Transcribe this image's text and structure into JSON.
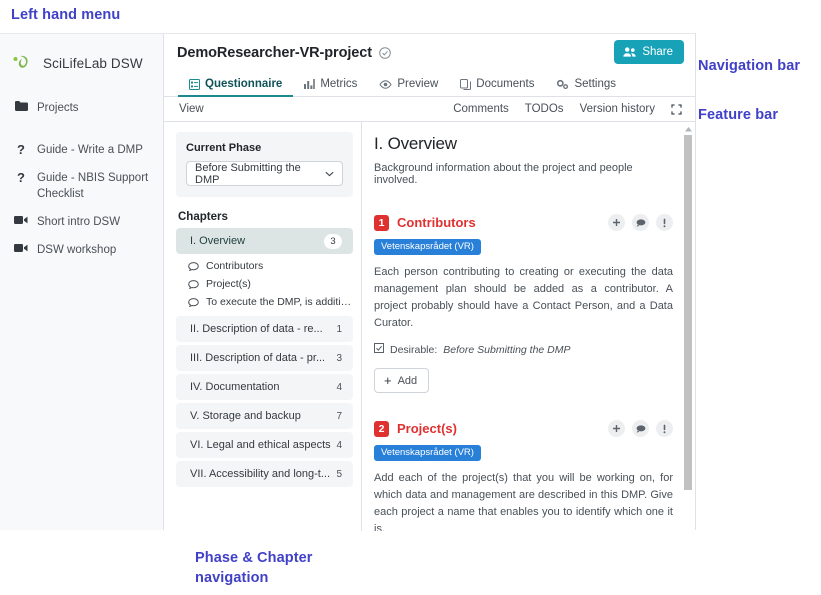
{
  "annotations": {
    "left_menu": "Left hand menu",
    "navigation_bar": "Navigation bar",
    "feature_bar": "Feature bar",
    "phase_chapter": "Phase & Chapter\nnavigation"
  },
  "colors": {
    "annotation": "#4040c8",
    "share_button": "#17a2b8",
    "badge_red": "#e03131",
    "tag_blue": "#2980d9",
    "active_tab": "#1a8a8f",
    "active_chapter_bg": "#dde5e4",
    "logo_green": "#8cc63f"
  },
  "sidebar": {
    "brand": "SciLifeLab DSW",
    "logo_icon": "scilifelab-leaf-logo",
    "items": [
      {
        "label": "Projects",
        "icon": "folder-icon"
      },
      {
        "label": "Guide - Write a DMP",
        "icon": "question-mark-icon"
      },
      {
        "label": "Guide - NBIS Support Checklist",
        "icon": "question-mark-icon"
      },
      {
        "label": "Short intro DSW",
        "icon": "video-camera-icon"
      },
      {
        "label": "DSW workshop",
        "icon": "video-camera-icon"
      }
    ]
  },
  "header": {
    "project_title": "DemoResearcher-VR-project",
    "title_check_icon": "check-circle-icon",
    "share_label": "Share",
    "share_icon": "users-icon"
  },
  "tabs": [
    {
      "label": "Questionnaire",
      "icon": "list-alt-icon",
      "active": true
    },
    {
      "label": "Metrics",
      "icon": "chart-bar-icon",
      "active": false
    },
    {
      "label": "Preview",
      "icon": "eye-icon",
      "active": false
    },
    {
      "label": "Documents",
      "icon": "copy-icon",
      "active": false
    },
    {
      "label": "Settings",
      "icon": "cogs-icon",
      "active": false
    }
  ],
  "feature_bar": {
    "view_label": "View",
    "comments_label": "Comments",
    "todos_label": "TODOs",
    "version_history_label": "Version history",
    "expand_icon": "expand-icon"
  },
  "phase": {
    "label": "Current Phase",
    "selected": "Before Submitting the DMP",
    "caret_icon": "chevron-down-icon"
  },
  "chapters_label": "Chapters",
  "chapters": [
    {
      "label": "I.  Overview",
      "count": "3",
      "active": true,
      "questions": [
        {
          "label": "Contributors",
          "icon": "comment-icon"
        },
        {
          "label": "Project(s)",
          "icon": "comment-icon"
        },
        {
          "label": "To execute the DMP, is addition...",
          "icon": "comment-icon"
        }
      ]
    },
    {
      "label": "II.  Description of data - re...",
      "count": "1",
      "active": false,
      "questions": []
    },
    {
      "label": "III.  Description of data - pr...",
      "count": "3",
      "active": false,
      "questions": []
    },
    {
      "label": "IV.  Documentation",
      "count": "4",
      "active": false,
      "questions": []
    },
    {
      "label": "V.  Storage and backup",
      "count": "7",
      "active": false,
      "questions": []
    },
    {
      "label": "VI.  Legal and ethical aspects",
      "count": "4",
      "active": false,
      "questions": []
    },
    {
      "label": "VII.  Accessibility and long-t...",
      "count": "5",
      "active": false,
      "questions": []
    }
  ],
  "content": {
    "chapter_title": "I. Overview",
    "chapter_desc": "Background information about the project and people involved.",
    "questions": [
      {
        "number": "1",
        "title": "Contributors",
        "tag": "Vetenskapsrådet (VR)",
        "text": "Each person contributing to creating or executing the data management plan should be added as a contributor. A project probably should have a Contact Person, and a Data Curator.",
        "desirable_prefix": "Desirable:",
        "desirable_phase": "Before Submitting the DMP",
        "desirable_icon": "checkbox-checked-icon",
        "add_label": "Add",
        "actions": [
          "plus-icon",
          "comment-icon",
          "exclamation-icon"
        ]
      },
      {
        "number": "2",
        "title": "Project(s)",
        "tag": "Vetenskapsrådet (VR)",
        "text": "Add each of the project(s) that you will be working on, for which data and management are described in this DMP. Give each project a name that enables you to identify which one it is.",
        "desirable_prefix": "",
        "desirable_phase": "",
        "desirable_icon": "",
        "add_label": "",
        "actions": [
          "plus-icon",
          "comment-icon",
          "exclamation-icon"
        ]
      }
    ]
  }
}
